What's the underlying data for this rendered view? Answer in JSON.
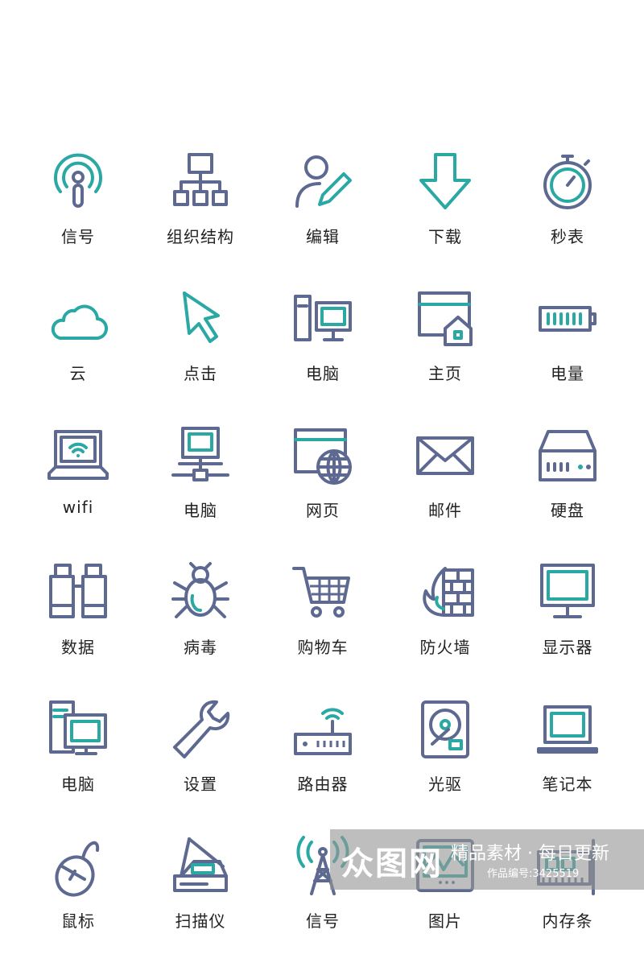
{
  "colors": {
    "primary": "#5d6990",
    "accent": "#2aa8a4"
  },
  "icons": [
    {
      "icon": "signal-icon",
      "label": "信号"
    },
    {
      "icon": "org-chart-icon",
      "label": "组织结构"
    },
    {
      "icon": "user-edit-icon",
      "label": "编辑"
    },
    {
      "icon": "download-arrow-icon",
      "label": "下载"
    },
    {
      "icon": "stopwatch-icon",
      "label": "秒表"
    },
    {
      "icon": "cloud-icon",
      "label": "云"
    },
    {
      "icon": "cursor-icon",
      "label": "点击"
    },
    {
      "icon": "desktop-computer-icon",
      "label": "电脑"
    },
    {
      "icon": "homepage-icon",
      "label": "主页"
    },
    {
      "icon": "battery-icon",
      "label": "电量"
    },
    {
      "icon": "laptop-wifi-icon",
      "label": "wifi"
    },
    {
      "icon": "network-computer-icon",
      "label": "电脑"
    },
    {
      "icon": "webpage-globe-icon",
      "label": "网页"
    },
    {
      "icon": "mail-icon",
      "label": "邮件"
    },
    {
      "icon": "hard-disk-icon",
      "label": "硬盘"
    },
    {
      "icon": "binoculars-icon",
      "label": "数据"
    },
    {
      "icon": "bug-icon",
      "label": "病毒"
    },
    {
      "icon": "shopping-cart-icon",
      "label": "购物车"
    },
    {
      "icon": "firewall-icon",
      "label": "防火墙"
    },
    {
      "icon": "monitor-icon",
      "label": "显示器"
    },
    {
      "icon": "pc-tower-icon",
      "label": "电脑"
    },
    {
      "icon": "wrench-icon",
      "label": "设置"
    },
    {
      "icon": "router-icon",
      "label": "路由器"
    },
    {
      "icon": "optical-drive-icon",
      "label": "光驱"
    },
    {
      "icon": "notebook-icon",
      "label": "笔记本"
    },
    {
      "icon": "mouse-icon",
      "label": "鼠标"
    },
    {
      "icon": "scanner-icon",
      "label": "扫描仪"
    },
    {
      "icon": "antenna-tower-icon",
      "label": "信号"
    },
    {
      "icon": "picture-icon",
      "label": "图片"
    },
    {
      "icon": "memory-stick-icon",
      "label": "内存条"
    }
  ],
  "watermark": {
    "logo": "众图网",
    "slogan": "精品素材 · 每日更新",
    "code": "作品编号:3425519"
  }
}
